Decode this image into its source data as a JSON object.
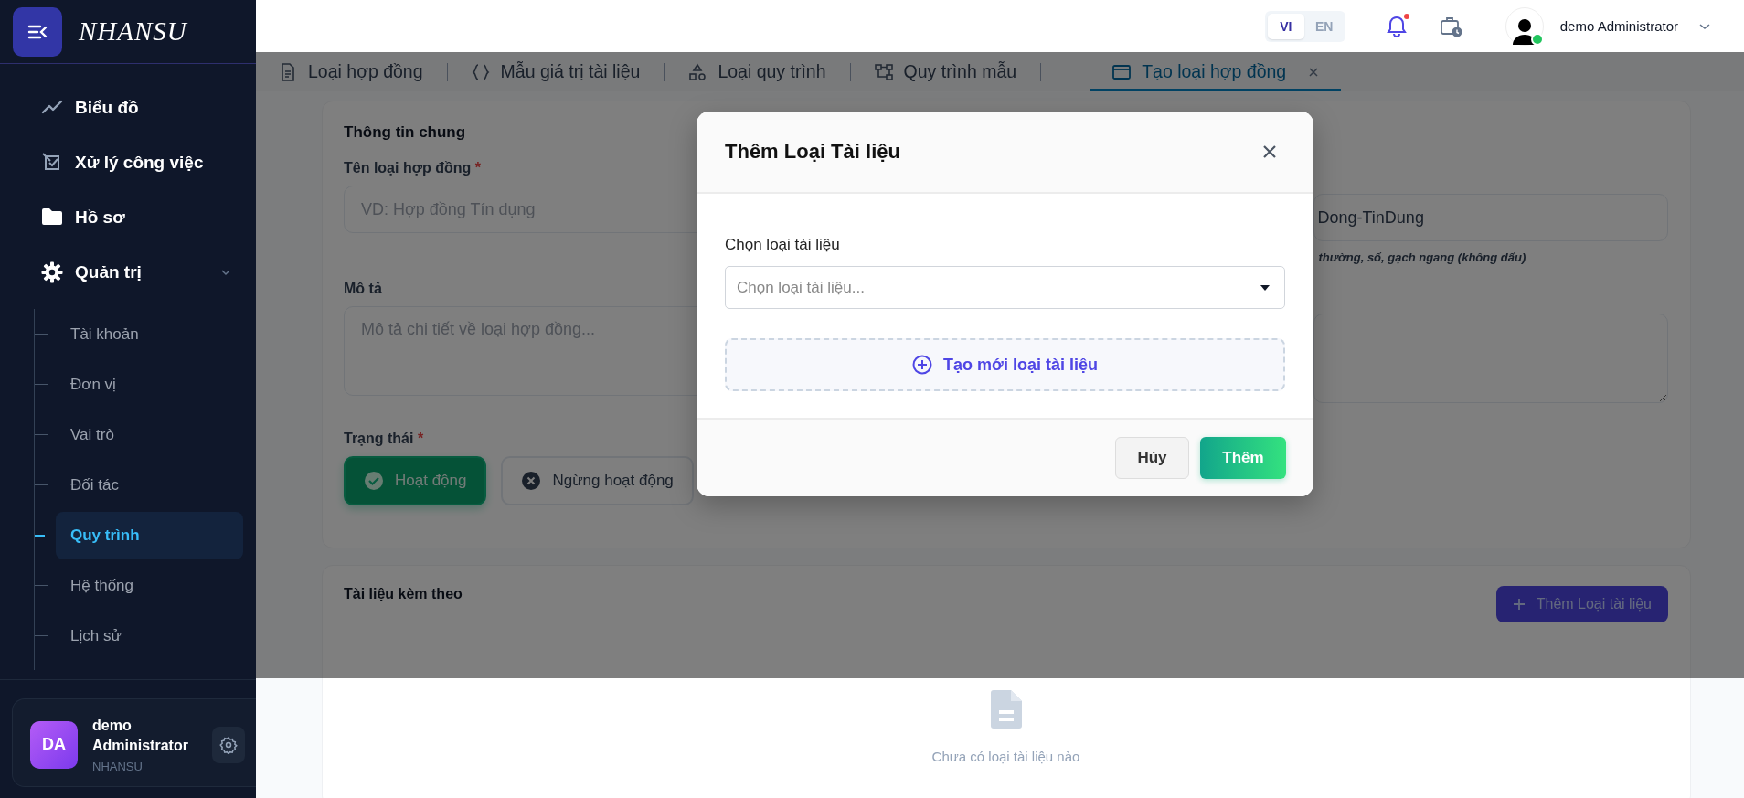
{
  "sidebar": {
    "brand": "NHANSU",
    "menu": [
      {
        "label": "Biểu đồ",
        "kind": "chart",
        "selected": false
      },
      {
        "label": "Xử lý công việc",
        "kind": "tasks",
        "selected": false
      },
      {
        "label": "Hồ sơ",
        "kind": "folder",
        "selected": false
      },
      {
        "label": "Quản trị",
        "kind": "settings",
        "selected": false,
        "expanded": true,
        "children": [
          {
            "label": "Tài khoản",
            "selected": false
          },
          {
            "label": "Đơn vị",
            "selected": false
          },
          {
            "label": "Vai trò",
            "selected": false
          },
          {
            "label": "Đối tác",
            "selected": false
          },
          {
            "label": "Quy trình",
            "selected": true
          },
          {
            "label": "Hệ thống",
            "selected": false
          },
          {
            "label": "Lịch sử",
            "selected": false
          }
        ]
      }
    ],
    "user_card": {
      "initials": "DA",
      "name": "demo Administrator",
      "org": "NHANSU"
    }
  },
  "header": {
    "languages": [
      {
        "label": "VI",
        "selected": true
      },
      {
        "label": "EN",
        "selected": false
      }
    ],
    "has_unread": true,
    "user": "demo Administrator",
    "online": true
  },
  "tabs": [
    {
      "label": "Loại hợp đồng",
      "kind": "document",
      "selected": false
    },
    {
      "label": "Mẫu giá trị tài liệu",
      "kind": "braces",
      "selected": false
    },
    {
      "label": "Loại quy trình",
      "kind": "shapes",
      "selected": false
    },
    {
      "label": "Quy trình mẫu",
      "kind": "flow",
      "selected": false
    },
    {
      "label": "Tạo loại hợp đồng",
      "kind": "window",
      "selected": true,
      "closable": true
    }
  ],
  "form": {
    "section_title": "Thông tin chung",
    "name_label": {
      "text": "Tên loại hợp đồng",
      "mark": "*"
    },
    "name_placeholder": "VD: Hợp đồng Tín dụng",
    "code_placeholder": "Dong-TinDung",
    "code_hint": "thường, số, gạch ngang (không dấu)",
    "description_label": "Mô tả",
    "description_placeholder": "Mô tả chi tiết về loại hợp đồng...",
    "status_label": {
      "text": "Trạng thái",
      "mark": "*"
    },
    "status_options": [
      {
        "label": "Hoạt động",
        "kind": "active",
        "selected": true
      },
      {
        "label": "Ngừng hoạt động",
        "kind": "inactive",
        "selected": false
      }
    ]
  },
  "attachments": {
    "title": "Tài liệu kèm theo",
    "add_button": "Thêm Loại tài liệu",
    "empty_text": "Chưa có loại tài liệu nào"
  },
  "modal": {
    "title": "Thêm Loại Tài liệu",
    "field_label": "Chọn loại tài liệu",
    "select_placeholder": "Chọn loại tài liệu...",
    "create_label": "Tạo mới loại tài liệu",
    "buttons": [
      {
        "label": "Hủy",
        "kind": "secondary"
      },
      {
        "label": "Thêm",
        "kind": "primary"
      }
    ]
  }
}
